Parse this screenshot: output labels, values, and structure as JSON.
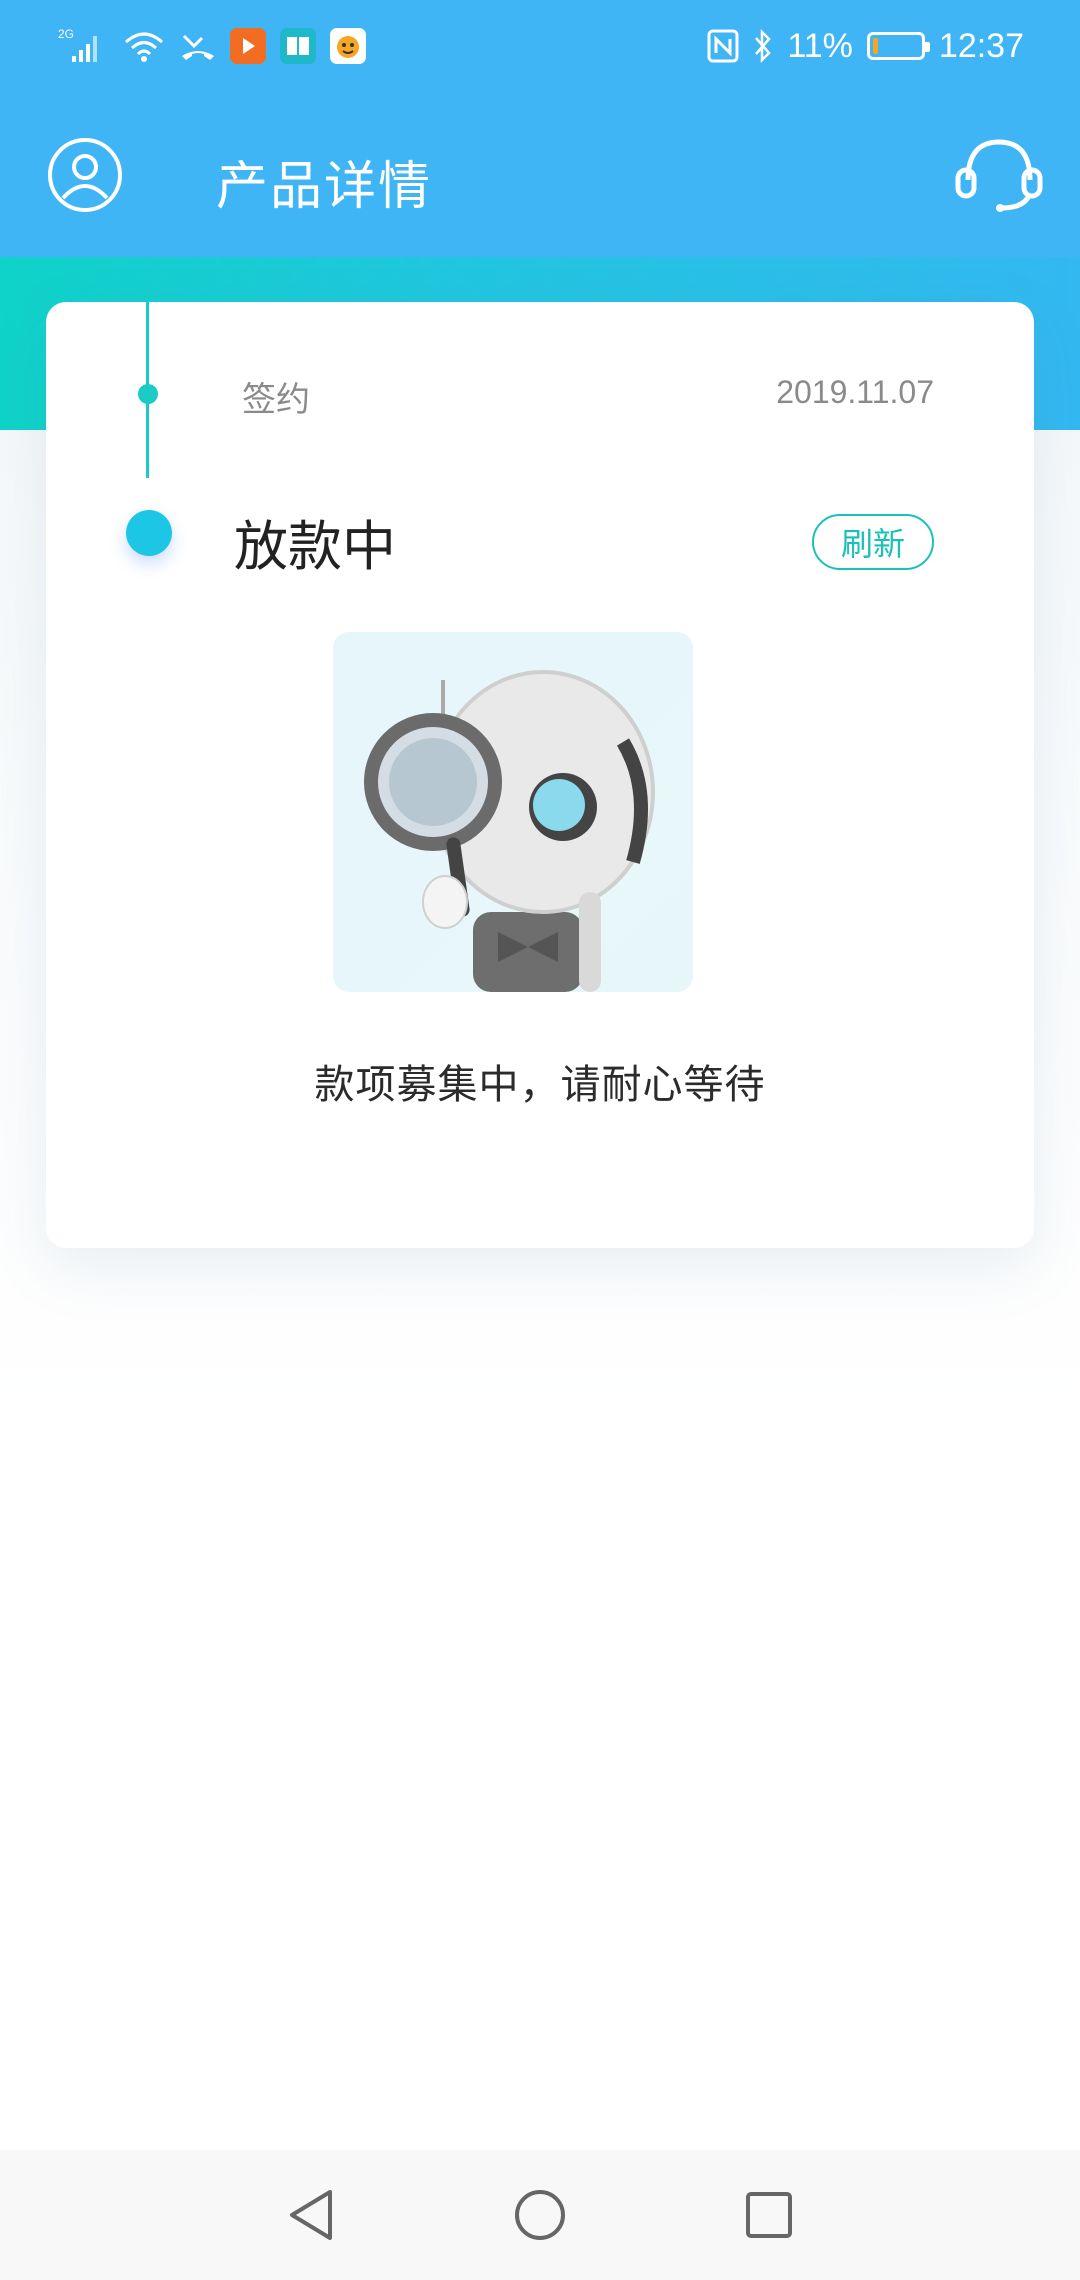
{
  "status_bar": {
    "network": "2G",
    "battery_text": "11%",
    "battery_level": 0.11,
    "time": "12:37",
    "app_icons": [
      "video-app-icon",
      "book-app-icon",
      "cartoon-app-icon"
    ],
    "status_icons": [
      "signal-icon",
      "wifi-icon",
      "missed-call-icon",
      "nfc-icon",
      "bluetooth-icon",
      "battery-icon"
    ]
  },
  "header": {
    "title": "产品详情",
    "left_icon": "user-profile-icon",
    "right_icon": "customer-service-headset-icon"
  },
  "timeline": {
    "step_completed": {
      "label": "签约",
      "date": "2019.11.07"
    },
    "step_current": {
      "label": "放款中",
      "action": "刷新"
    }
  },
  "illustration": {
    "icon": "robot-magnifier-illustration"
  },
  "message": "款项募集中，请耐心等待",
  "navbar": {
    "icons": [
      "back-triangle-icon",
      "home-circle-icon",
      "recent-square-icon"
    ]
  },
  "colors": {
    "header_blue": "#3fb5f5",
    "accent_teal": "#19c1b8",
    "dot_blue": "#1ec6e6",
    "battery_orange": "#f5a623"
  }
}
